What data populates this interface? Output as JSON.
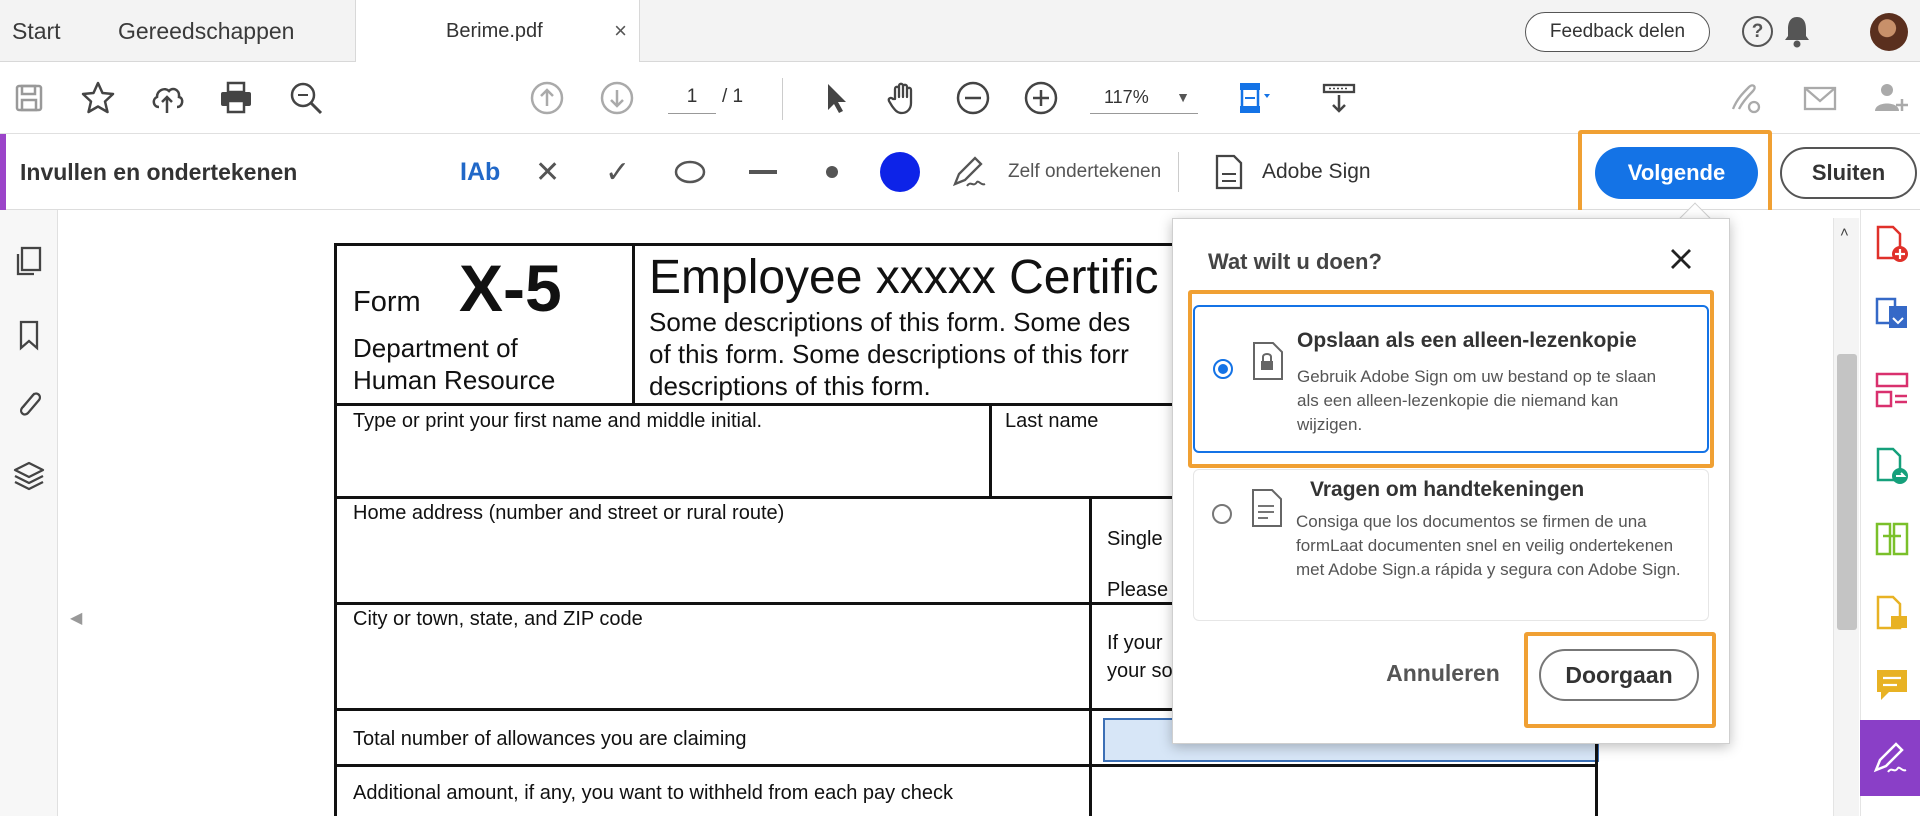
{
  "tabs": {
    "start": "Start",
    "tools": "Gereedschappen",
    "document": "Berime.pdf",
    "close_glyph": "×"
  },
  "header": {
    "feedback_label": "Feedback delen",
    "help_glyph": "?"
  },
  "toolbar": {
    "page_current": "1",
    "page_total": "/ 1",
    "zoom": "117%",
    "zoom_caret": "▼"
  },
  "fill_sign": {
    "title": "Invullen en ondertekenen",
    "text_tool": "IAb",
    "x_tool": "✕",
    "check_tool": "✓",
    "self_sign": "Zelf ondertekenen",
    "adobe_sign": "Adobe Sign",
    "next_button": "Volgende",
    "close_button": "Sluiten",
    "ink_color": "#0d23e8",
    "accent_color": "#9b44c9"
  },
  "form": {
    "form_word": "Form",
    "form_number": "X-5",
    "department_line1": "Department of",
    "department_line2": "Human Resource",
    "title": "Employee xxxxx Certific",
    "desc_line1": "Some descriptions of this form. Some des",
    "desc_line2": "of this form. Some descriptions of this forr",
    "desc_line3": "descriptions of this form.",
    "first_name_label": "Type or print your first name and middle initial.",
    "last_name_label": "Last name",
    "home_address_label": "Home address (number and street or rural route)",
    "single_label": "Single",
    "please_label": "Please",
    "city_label": "City or town, state, and ZIP code",
    "if_your_label": "If your",
    "your_so_label": "your so",
    "allowances_label": "Total number of allowances you are claiming",
    "additional_label": "Additional amount, if any, you want to withheld from each pay check"
  },
  "popup": {
    "title": "Wat wilt u doen?",
    "option1_title": "Opslaan als een alleen-lezenkopie",
    "option1_desc": "Gebruik Adobe Sign om uw bestand op te slaan als een alleen-lezenkopie die niemand kan wijzigen.",
    "option2_title": "Vragen om handtekeningen",
    "option2_desc": "Consiga que los documentos se firmen de una formLaat documenten snel en veilig ondertekenen met Adobe Sign.a rápida y segura con Adobe Sign.",
    "cancel_button": "Annuleren",
    "continue_button": "Doorgaan",
    "highlight_color": "#f0a033",
    "selected_color": "#1473e6"
  },
  "scrollbar": {
    "up_glyph": "˄"
  }
}
